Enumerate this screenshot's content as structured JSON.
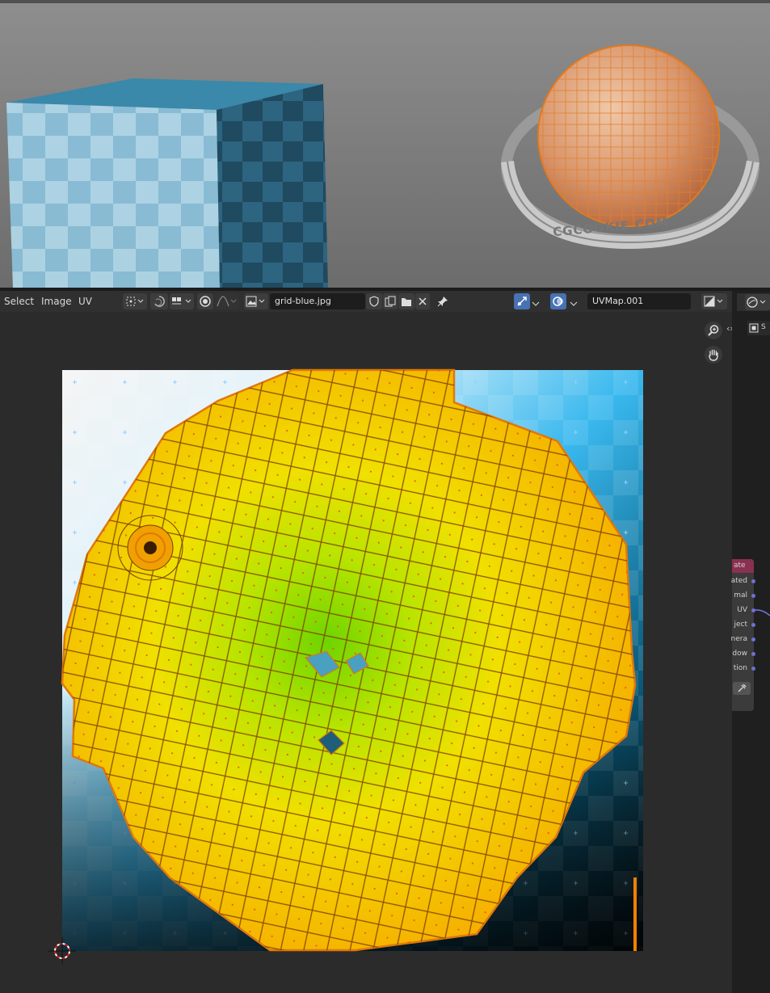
{
  "menus": {
    "select": "Select",
    "image": "Image",
    "uv": "UV"
  },
  "image_name": "grid-blue.jpg",
  "uv_map_name": "UVMap.001",
  "viewport": {
    "watermark": "CGCOOKIE.COM"
  },
  "node": {
    "header_fragment": "ate",
    "sockets": [
      "ated",
      "mal",
      "UV",
      "ject",
      "nera",
      "dow",
      "tion"
    ]
  },
  "sidebar_tab_fragment": "S",
  "colors": {
    "header_bg": "#303030",
    "area_bg": "#2b2b2b",
    "selection_orange": "#e0780a",
    "face_yellow": "#f2c400",
    "face_green": "#78d400",
    "active_blue": "#4772b3"
  },
  "icons": [
    "select-mode-icon",
    "sync-selection-icon",
    "sticky-selection-icon",
    "proportional-icon",
    "falloff-icon",
    "image-browse-icon",
    "fake-user-shield-icon",
    "new-image-icon",
    "open-image-icon",
    "unlink-x-icon",
    "pin-icon",
    "uv-sync-icon",
    "overlay-icon",
    "display-channels-icon",
    "viewport-shading-icon",
    "zoom-icon",
    "hand-pan-icon",
    "2d-cursor-icon"
  ]
}
